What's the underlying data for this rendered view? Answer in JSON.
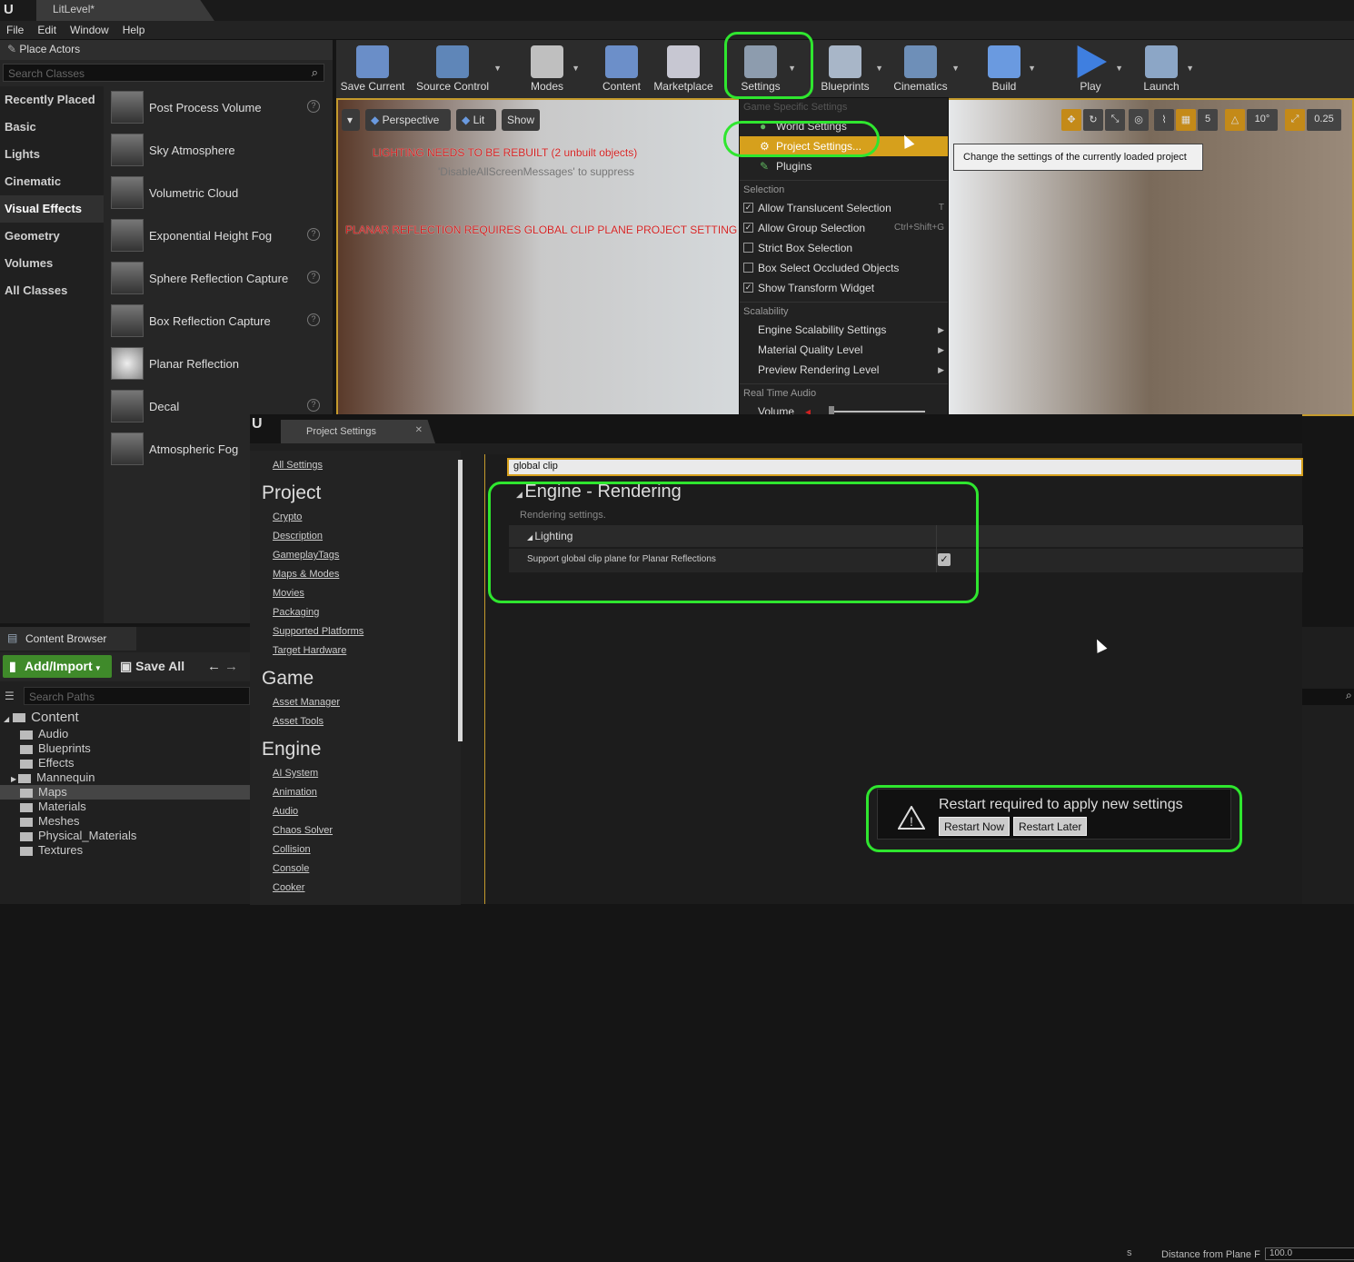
{
  "titlebar": {
    "tab": "LitLevel*"
  },
  "menubar": {
    "items": [
      "File",
      "Edit",
      "Window",
      "Help"
    ]
  },
  "place_actors": {
    "title": "Place Actors",
    "search_placeholder": "Search Classes",
    "categories": [
      "Recently Placed",
      "Basic",
      "Lights",
      "Cinematic",
      "Visual Effects",
      "Geometry",
      "Volumes",
      "All Classes"
    ],
    "selected_category": "Visual Effects",
    "items": [
      "Post Process Volume",
      "Sky Atmosphere",
      "Volumetric Cloud",
      "Exponential Height Fog",
      "Sphere Reflection Capture",
      "Box Reflection Capture",
      "Planar Reflection",
      "Decal",
      "Atmospheric Fog"
    ]
  },
  "toolbar": {
    "save_current": "Save Current",
    "source_control": "Source Control",
    "modes": "Modes",
    "content": "Content",
    "marketplace": "Marketplace",
    "settings": "Settings",
    "blueprints": "Blueprints",
    "cinematics": "Cinematics",
    "build": "Build",
    "play": "Play",
    "launch": "Launch"
  },
  "viewport": {
    "perspective": "Perspective",
    "lit": "Lit",
    "show": "Show",
    "warning_rebuild": "LIGHTING NEEDS TO BE REBUILT (2 unbuilt objects)",
    "warning_suppress": "'DisableAllScreenMessages' to suppress",
    "warning_planar": "PLANAR REFLECTION REQUIRES GLOBAL CLIP PLANE PROJECT SETTING E",
    "grid_value": "5",
    "rotation_value": "10°",
    "scale_value": "0.25"
  },
  "settings_menu": {
    "section_game": "Game Specific Settings",
    "world_settings": "World Settings",
    "project_settings": "Project Settings...",
    "plugins": "Plugins",
    "section_selection": "Selection",
    "selection_items": [
      {
        "label": "Allow Translucent Selection",
        "shortcut": "T"
      },
      {
        "label": "Allow Group Selection",
        "shortcut": "Ctrl+Shift+G"
      },
      {
        "label": "Strict Box Selection",
        "shortcut": ""
      },
      {
        "label": "Box Select Occluded Objects",
        "shortcut": ""
      },
      {
        "label": "Show Transform Widget",
        "shortcut": ""
      }
    ],
    "section_scalability": "Scalability",
    "scalability_items": [
      "Engine Scalability Settings",
      "Material Quality Level",
      "Preview Rendering Level"
    ],
    "section_audio": "Real Time Audio",
    "volume": "Volume"
  },
  "tooltip": "Change the settings of the currently loaded project",
  "project_settings": {
    "tab": "Project Settings",
    "all_settings": "All Settings",
    "groups": [
      {
        "title": "Project",
        "items": [
          "Crypto",
          "Description",
          "GameplayTags",
          "Maps & Modes",
          "Movies",
          "Packaging",
          "Supported Platforms",
          "Target Hardware"
        ]
      },
      {
        "title": "Game",
        "items": [
          "Asset Manager",
          "Asset Tools"
        ]
      },
      {
        "title": "Engine",
        "items": [
          "AI System",
          "Animation",
          "Audio",
          "Chaos Solver",
          "Collision",
          "Console",
          "Cooker"
        ]
      }
    ],
    "search_value": "global clip",
    "category_title": "Engine - Rendering",
    "category_desc": "Rendering settings.",
    "section": "Lighting",
    "setting_label": "Support global clip plane for Planar Reflections",
    "setting_checked": true
  },
  "toast": {
    "message": "Restart required to apply new settings",
    "restart_now": "Restart Now",
    "restart_later": "Restart Later",
    "underlying_label": "Distance from Plane F",
    "underlying_value": "100.0"
  },
  "content_browser": {
    "tab": "Content Browser",
    "add_import": "Add/Import",
    "save_all": "Save All",
    "search_placeholder": "Search Paths",
    "root": "Content",
    "folders": [
      "Audio",
      "Blueprints",
      "Effects",
      "Mannequin",
      "Maps",
      "Materials",
      "Meshes",
      "Physical_Materials",
      "Textures"
    ],
    "selected_folder": "Maps"
  },
  "colors": {
    "accent": "#d6a01c",
    "highlight_ring": "#2fe62f",
    "warning_text": "#d02020"
  }
}
